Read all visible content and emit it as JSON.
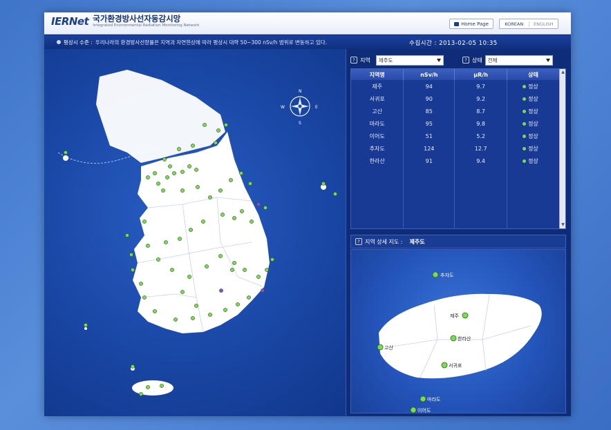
{
  "header": {
    "logo_mark": "IERNet",
    "title": "국가환경방사선자동감시망",
    "subtitle": "Integrated Environmental Radiation Monitoring Network",
    "home_label": "Home Page",
    "lang_korean": "KOREAN",
    "lang_english": "ENGLISH"
  },
  "notice": {
    "label": "평상시 수준 :",
    "text": "우리나라의 환경방사선량률은 지역과 자연현상에 따라 평상시 대략 50~300 nSv/h 범위로 변동하고 있다.",
    "time_label": "수집시간 :",
    "time_value": "2013-02-05 10:35"
  },
  "compass": {
    "n": "N",
    "s": "S",
    "e": "E",
    "w": "W"
  },
  "filters": {
    "region_label": "지역",
    "region_value": "제주도",
    "status_label": "상태",
    "status_value": "전체"
  },
  "table": {
    "columns": [
      "지역명",
      "nSv/h",
      "μR/h",
      "상태"
    ],
    "rows": [
      {
        "name": "제주",
        "nsv": "94",
        "ur": "9.7",
        "status": "정상"
      },
      {
        "name": "서귀포",
        "nsv": "90",
        "ur": "9.2",
        "status": "정상"
      },
      {
        "name": "고산",
        "nsv": "85",
        "ur": "8.7",
        "status": "정상"
      },
      {
        "name": "마라도",
        "nsv": "95",
        "ur": "9.8",
        "status": "정상"
      },
      {
        "name": "이어도",
        "nsv": "51",
        "ur": "5.2",
        "status": "정상"
      },
      {
        "name": "추자도",
        "nsv": "124",
        "ur": "12.7",
        "status": "정상"
      },
      {
        "name": "한라산",
        "nsv": "91",
        "ur": "9.4",
        "status": "정상"
      }
    ]
  },
  "detail": {
    "label": "지역 상세 지도 :",
    "region": "제주도",
    "stations": {
      "chuja": "추자도",
      "jeju": "제주",
      "gosan": "고산",
      "halla": "한라산",
      "seogwipo": "서귀포",
      "mara": "마라도",
      "ieo": "이어도"
    }
  },
  "colors": {
    "station_normal": "#7ed957",
    "station_alt": "#8a4fd6"
  }
}
